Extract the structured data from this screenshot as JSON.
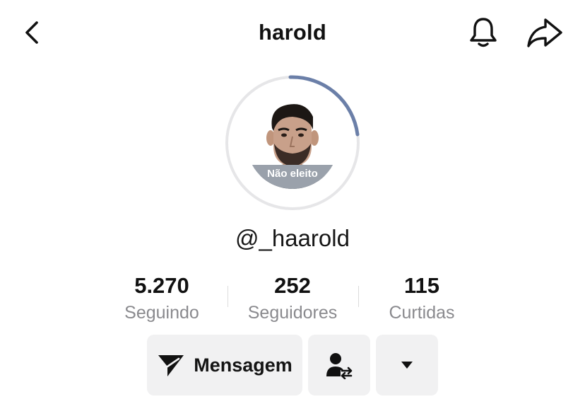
{
  "header": {
    "title": "harold",
    "back_icon": "chevron-left-icon",
    "notification_icon": "bell-icon",
    "share_icon": "share-arrow-icon"
  },
  "profile": {
    "handle": "@_haarold",
    "badge_text": "Não eleito",
    "ring_progress_color": "#6b7fa8"
  },
  "stats": [
    {
      "value": "5.270",
      "label": "Seguindo"
    },
    {
      "value": "252",
      "label": "Seguidores"
    },
    {
      "value": "115",
      "label": "Curtidas"
    }
  ],
  "actions": {
    "message_label": "Mensagem",
    "message_icon": "send-icon",
    "follow_icon": "user-swap-icon",
    "more_icon": "caret-down-icon"
  }
}
